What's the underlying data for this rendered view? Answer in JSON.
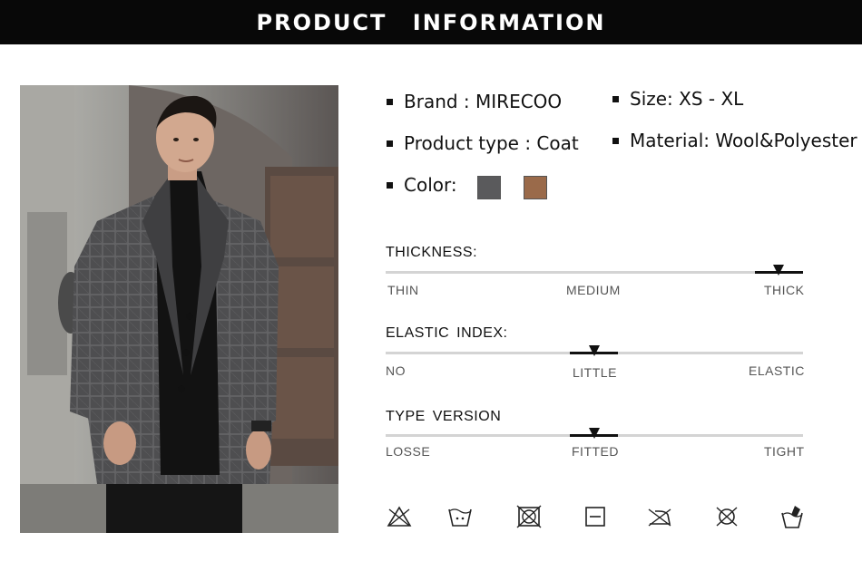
{
  "header": {
    "title": "PRODUCT INFORMATION"
  },
  "specs": {
    "brand": "Brand : MIRECOO",
    "product_type": "Product type : Coat",
    "color": "Color:",
    "size": "Size: XS - XL",
    "material": "Material: Wool&Polyester"
  },
  "colors": [
    {
      "name": "grey",
      "hex": "#5a5a5c"
    },
    {
      "name": "brown",
      "hex": "#9a6a4a"
    }
  ],
  "meters": {
    "thickness": {
      "title": "THICKNESS:",
      "labels": [
        "THIN",
        "MEDIUM",
        "THICK"
      ],
      "selected": "THICK"
    },
    "elastic": {
      "title": "ELASTIC  INDEX:",
      "labels": [
        "NO",
        "LITTLE",
        "ELASTIC"
      ],
      "selected": "LITTLE"
    },
    "type_version": {
      "title": "TYPE  VERSION",
      "labels": [
        "LOSSE",
        "FITTED",
        "TIGHT"
      ],
      "selected": "FITTED"
    }
  },
  "care_icons": [
    "do-not-bleach-icon",
    "hand-wash-icon",
    "do-not-tumble-dry-icon",
    "dry-flat-icon",
    "do-not-iron-icon",
    "do-not-dry-clean-icon",
    "hand-wash-only-icon"
  ]
}
